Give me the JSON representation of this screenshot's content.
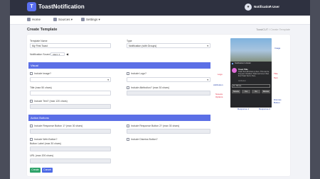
{
  "brand": {
    "name": "ToastNotification",
    "suffix": ".com",
    "badge": "T"
  },
  "user": {
    "avatar": "●",
    "name": "Notification User",
    "caret": "▾"
  },
  "nav": [
    {
      "icon": "home-icon",
      "label": "Home"
    },
    {
      "icon": "sources-icon",
      "label": "Sources ▾"
    },
    {
      "icon": "settings-icon",
      "label": "Settings ▾"
    }
  ],
  "header": {
    "title": "Create Template",
    "breadcrumb_root": "ToastCUT",
    "breadcrumb_sep": "/",
    "breadcrumb_current": "Create Template"
  },
  "form": {
    "template_name_label": "Template Name",
    "template_name_value": "My First Toast",
    "type_label": "Type",
    "type_value": "Notification (with Groups)",
    "notification_sound_label": "Notification Sound",
    "notification_sound_value": "Alarm 1",
    "visual_section": "Visual",
    "include_image_label": "Include Image?",
    "include_logo_label": "Include Logo?",
    "title_label": "Title (max 50 chars)",
    "include_attribution_label": "Include Attribution? (max 30 chars)",
    "include_text_label": "Include Text? (max 120 chars)",
    "action_buttons_section": "Action Buttons",
    "include_response_1_label": "Include Response Button 1? (max 30 chars)",
    "include_response_2_label": "Include Response Button 2? (max 30 chars)",
    "include_web_label": "Include Web Button?",
    "include_dismiss_label": "Include Dismiss Button?",
    "button_label_label": "Button Label (max 30 chars)",
    "url_label": "URL (max 200 chars)",
    "create_button": "Create",
    "cancel_button": "Cancel"
  },
  "preview": {
    "app_name": "Notification Includer",
    "toast_title": "Toast Title",
    "toast_text": "Toast Text will show up here. This can be long text. Doubled. Toast text here it flow their Toast Text is Here.",
    "toast_attribution": "Attribution",
    "dropdown_value": "Ex: Minute",
    "response_1": "Snooze",
    "response_2": "Yes",
    "response_3": "No",
    "dismiss": "Dismiss"
  },
  "annotations": {
    "image": "Image",
    "logo": "Logo",
    "title_text": "Title",
    "text": "Text",
    "attribution": "Attribution",
    "snooze": "Snooze",
    "options": "Options",
    "dismiss": "Dismiss",
    "button": "Button",
    "response_1": "Response 1",
    "response_2": "Response 2"
  },
  "colors": {
    "accent": "#5b6fe6",
    "topbar": "#2e3140",
    "create": "#2fa36b",
    "cancel": "#4d6ae6",
    "annotation_blue": "#1f3ea8",
    "annotation_red": "#e0203a"
  }
}
